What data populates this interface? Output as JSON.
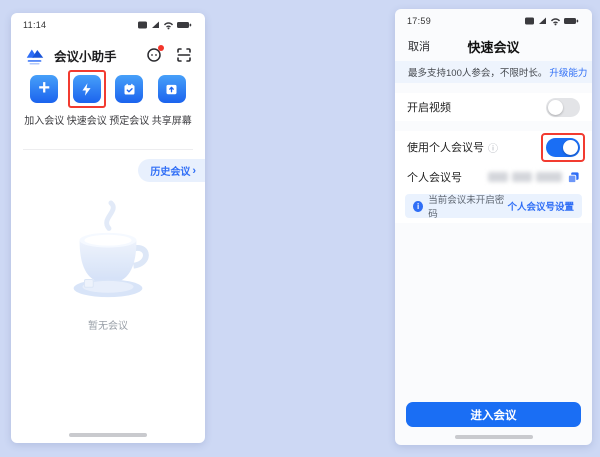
{
  "canvas": {
    "background": "#cdd8f4"
  },
  "icons": {
    "plus": "+",
    "chevron_right": "›",
    "info_circle": "ⓘ",
    "info_letter": "i"
  },
  "colors": {
    "accent_blue": "#1a6ef4",
    "link_blue": "#2f6ef6",
    "highlight_red": "#f23b30",
    "banner_bg": "#eef4fd",
    "toggle_off": "#e3e4e7"
  },
  "left_phone": {
    "statusbar": {
      "time": "11:14"
    },
    "header": {
      "app_title": "会议小助手"
    },
    "actions": [
      {
        "label": "加入会议",
        "icon": "plus"
      },
      {
        "label": "快速会议",
        "icon": "bolt",
        "highlighted": true
      },
      {
        "label": "预定会议",
        "icon": "calendar-check"
      },
      {
        "label": "共享屏幕",
        "icon": "screen-share"
      }
    ],
    "history_link": {
      "label": "历史会议",
      "chevron": "›"
    },
    "empty_state": {
      "text": "暂无会议"
    }
  },
  "right_phone": {
    "statusbar": {
      "time": "17:59"
    },
    "nav": {
      "cancel": "取消",
      "title": "快速会议"
    },
    "capacity_banner": {
      "text": "最多支持100人参会，不限时长。",
      "link": "升级能力"
    },
    "settings": {
      "video_row": {
        "label": "开启视频",
        "state": "off"
      },
      "personal_id_toggle_row": {
        "label": "使用个人会议号",
        "state": "on",
        "highlighted": true
      },
      "personal_id_row": {
        "label": "个人会议号",
        "value_masked": true
      },
      "notice": {
        "text": "当前会议未开启密码",
        "link": "个人会议号设置"
      }
    },
    "enter_button": {
      "label": "进入会议"
    }
  }
}
